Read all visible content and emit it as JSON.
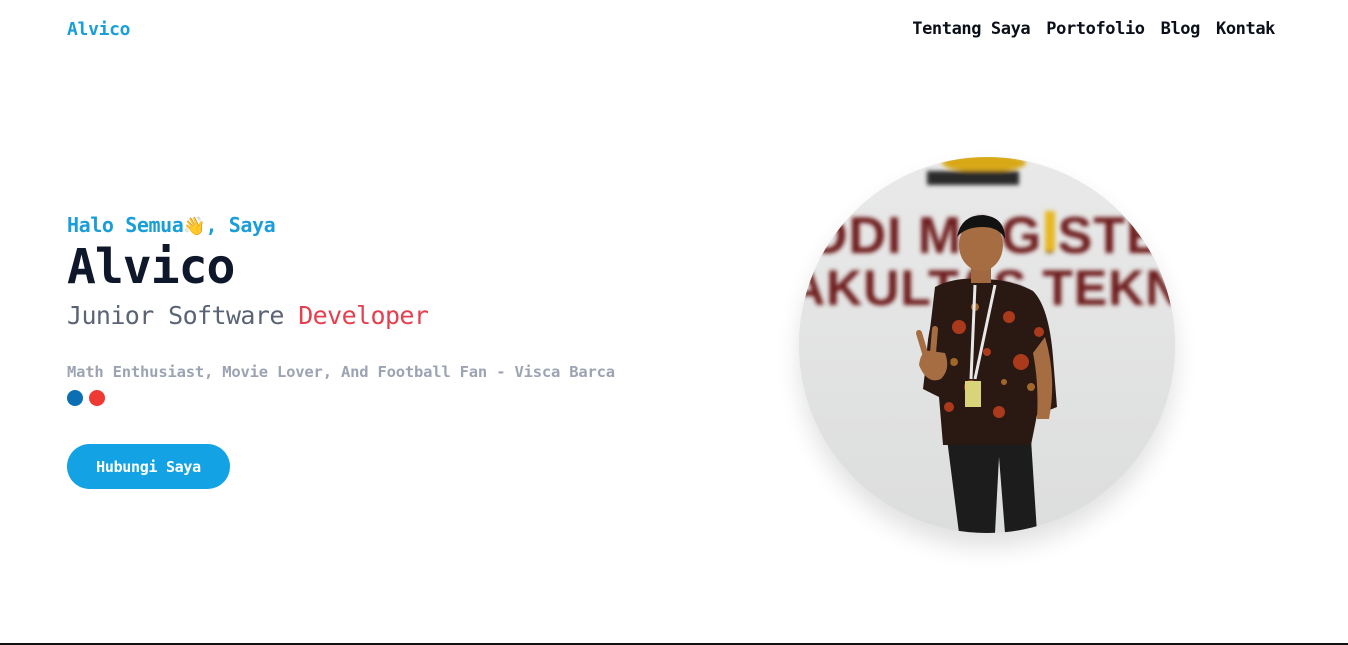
{
  "brand": "Alvico",
  "nav": {
    "about": "Tentang Saya",
    "portfolio": "Portofolio",
    "blog": "Blog",
    "contact": "Kontak"
  },
  "hero": {
    "greeting_before": "Halo Semua",
    "wave_emoji": "👋",
    "greeting_after": ", Saya",
    "name": "Alvico",
    "role_prefix": "Junior Software ",
    "role_accent": "Developer",
    "tagline": "Math Enthusiast, Movie Lover, And Football Fan - Visca Barca",
    "cta_label": "Hubungi Saya"
  },
  "photo": {
    "banner_text_line1": "ODI MAGISTE",
    "banner_text_line2": "AKULTAS TEKNI"
  },
  "colors": {
    "accent": "#1a9ed9",
    "button": "#13a2e4",
    "highlight": "#e5404f",
    "barca_blue": "#0a6fb3",
    "barca_red": "#ef3a33"
  }
}
